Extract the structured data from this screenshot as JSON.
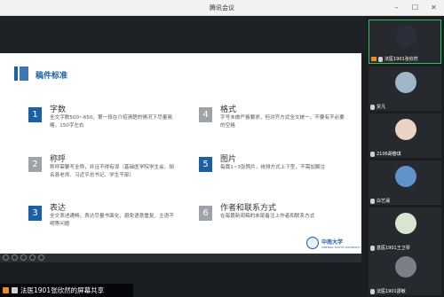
{
  "app_title": "腾讯会议",
  "window_controls": [
    "–",
    "☐",
    "✕"
  ],
  "slide": {
    "title": "稿件标准",
    "items": [
      {
        "num": "1",
        "title": "字数",
        "desc": "全文字数500~650，第一段在介绍清楚的情况下尽量简略，150字左右",
        "style": "blue"
      },
      {
        "num": "2",
        "title": "称呼",
        "desc": "称呼需要写全称，并且不得有误（基础医学院学生会、胡名县老师、习近平总书记、学生干部）",
        "style": "grey"
      },
      {
        "num": "3",
        "title": "表达",
        "desc": "全文表述通畅，表达尽量书面化，避免语意重复、主语不明等问题",
        "style": "blue"
      },
      {
        "num": "4",
        "title": "格式",
        "desc": "字号未做严格要求，但对齐方式全文统一，不要有不必要的空格",
        "style": "grey"
      },
      {
        "num": "5",
        "title": "图片",
        "desc": "每篇1~3张照片，绕排方式上下型，不需加脚注",
        "style": "blue"
      },
      {
        "num": "6",
        "title": "作者和联系方式",
        "desc": "在每篇新闻稿的末尾备注上作者和联系方式",
        "style": "grey"
      }
    ],
    "logo_name": "中南大学",
    "logo_sub": "CENTRAL SOUTH UNIVERSITY"
  },
  "screen_share_label": "法医1901张欣然的屏幕共享",
  "participants": [
    {
      "name": "法医1901张欣然",
      "color": "#2b2f3a",
      "active": true
    },
    {
      "name": "贾凡",
      "color": "#9fb6c8",
      "active": false
    },
    {
      "name": "2106胡春琪",
      "color": "#e8d3c4",
      "active": false
    },
    {
      "name": "白艺澜",
      "color": "#5f93c9",
      "active": false
    },
    {
      "name": "基医1901王卫琴",
      "color": "#d8e6d0",
      "active": false
    },
    {
      "name": "法医1901邵敏",
      "color": "#7a7f88",
      "active": false
    }
  ],
  "colors": {
    "accent": "#1b5fa6",
    "active_border": "#2fbf5e",
    "mute_orange": "#f28a22"
  }
}
